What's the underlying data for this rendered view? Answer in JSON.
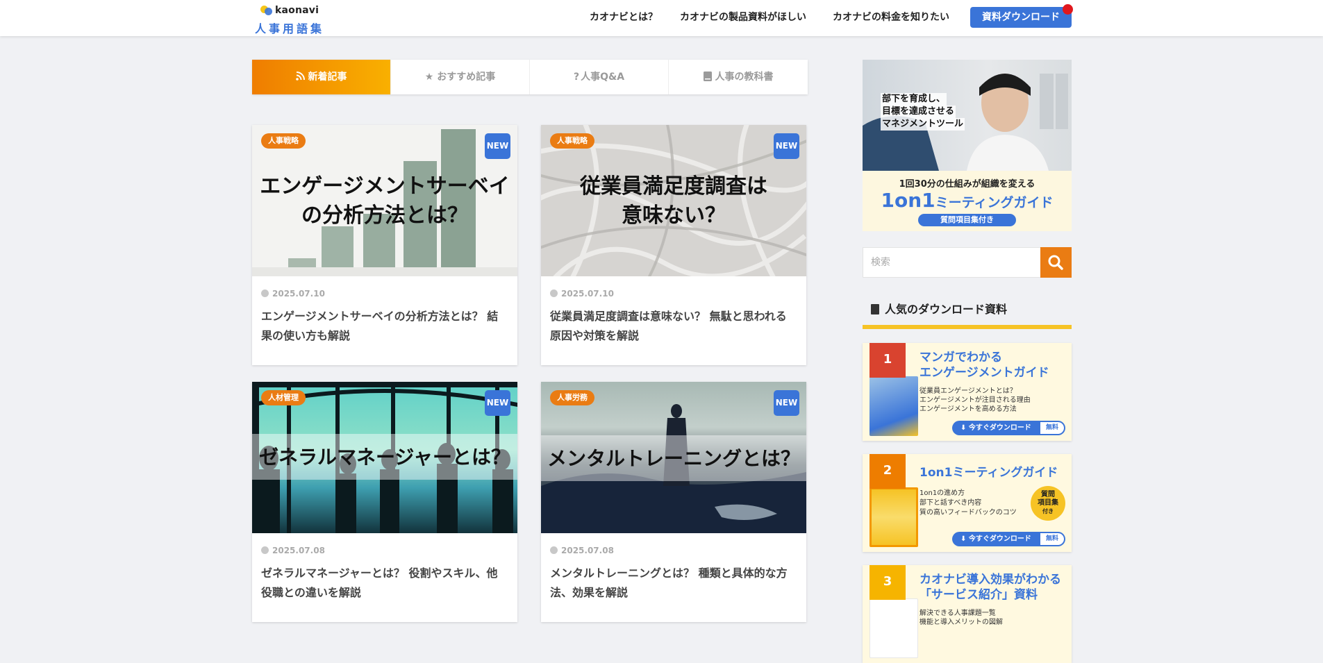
{
  "header": {
    "logo_text": "kaonavi",
    "logo_sub": "人事用語集",
    "nav": [
      "カオナビとは？",
      "カオナビの製品資料がほしい",
      "カオナビの料金を知りたい"
    ],
    "download_button": "資料ダウンロード"
  },
  "tabs": [
    {
      "label": "新着記事",
      "icon": "rss-icon"
    },
    {
      "label": "おすすめ記事",
      "icon": "star-icon"
    },
    {
      "label": "人事Q&A",
      "icon": "question-icon"
    },
    {
      "label": "人事の教科書",
      "icon": "book-icon"
    }
  ],
  "articles": [
    {
      "tag": "人事戦略",
      "badge": "NEW",
      "headline1": "エンゲージメントサーベイ",
      "headline2": "の分析方法とは？",
      "date": "2025.07.10",
      "title": "エンゲージメントサーベイの分析方法とは？ 結果の使い方も解説"
    },
    {
      "tag": "人事戦略",
      "badge": "NEW",
      "headline1": "従業員満足度調査は",
      "headline2": "意味ない？",
      "date": "2025.07.10",
      "title": "従業員満足度調査は意味ない？ 無駄と思われる原因や対策を解説"
    },
    {
      "tag": "人材管理",
      "badge": "NEW",
      "headline1": "ゼネラルマネージャーとは？",
      "headline2": "",
      "date": "2025.07.08",
      "title": "ゼネラルマネージャーとは？ 役割やスキル、他役職との違いを解説"
    },
    {
      "tag": "人事労務",
      "badge": "NEW",
      "headline1": "メンタルトレーニングとは？",
      "headline2": "",
      "date": "2025.07.08",
      "title": "メンタルトレーニングとは？ 種類と具体的な方法、効果を解説"
    }
  ],
  "banner": {
    "lines": [
      "部下を育成し、",
      "目標を達成させる",
      "マネジメントツール"
    ],
    "caption": "1回30分の仕組みが組織を変える",
    "title_a": "1on1",
    "title_b": "ミーティングガイド",
    "pill": "質問項目集付き"
  },
  "search": {
    "placeholder": "検索"
  },
  "popular": {
    "heading": "人気のダウンロード資料",
    "items": [
      {
        "rank": "1",
        "color": "#d9432f",
        "title1": "マンガでわかる",
        "title2": "エンゲージメントガイド",
        "bullets": [
          "従業員エンゲージメントとは？",
          "エンゲージメントが注目される理由",
          "エンゲージメントを高める方法"
        ],
        "button": "今すぐダウンロード",
        "free": "無料"
      },
      {
        "rank": "2",
        "color": "#ee7d00",
        "title1": "1on1ミーティングガイド",
        "title2": "",
        "bullets": [
          "1on1の進め方",
          "部下と話すべき内容",
          "質の高いフィードバックのコツ"
        ],
        "badge": [
          "質問",
          "項目集",
          "付き"
        ],
        "button": "今すぐダウンロード",
        "free": "無料"
      },
      {
        "rank": "3",
        "color": "#f6b400",
        "title1": "カオナビ導入効果がわかる",
        "title2": "「サービス紹介」資料",
        "bullets": [
          "解決できる人事課題一覧",
          "機能と導入メリットの図解"
        ],
        "button": "",
        "free": ""
      }
    ]
  }
}
